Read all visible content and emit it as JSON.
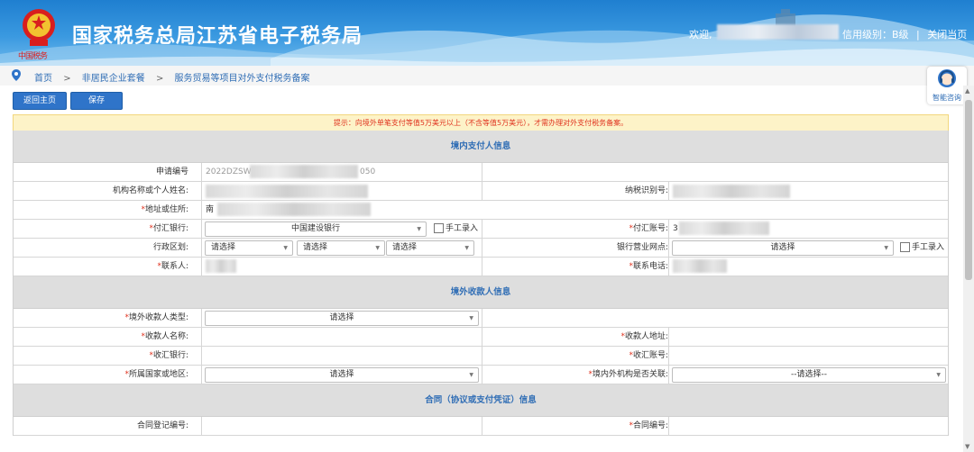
{
  "header": {
    "site_title": "国家税务总局江苏省电子税务局",
    "brand_text": "中国税务",
    "welcome": "欢迎,",
    "credit_level": "信用级别：B级",
    "separator": "|",
    "close_page": "关闭当页"
  },
  "breadcrumb": {
    "items": [
      "首页",
      "非居民企业套餐",
      "服务贸易等项目对外支付税务备案"
    ],
    "arrow": ">"
  },
  "consult": {
    "label": "智能咨询"
  },
  "toolbar": {
    "home": "返回主页",
    "save": "保存"
  },
  "notice": "提示：向境外单笔支付等值5万美元以上（不含等值5万美元），才需办理对外支付税务备案。",
  "sections": {
    "domestic": "境内支付人信息",
    "overseas": "境外收款人信息",
    "contract": "合同（协议或支付凭证）信息"
  },
  "domestic": {
    "app_no_label": "申请编号",
    "app_no_prefix": "2022DZSW",
    "app_no_suffix": "050",
    "org_name_label": "机构名称或个人姓名:",
    "tax_id_label": "纳税识别号:",
    "address_label": "地址或住所:",
    "address_prefix": "南",
    "bank_label": "付汇银行:",
    "bank_value": "中国建设银行",
    "manual_entry": "手工录入",
    "account_label": "付汇账号:",
    "account_prefix": "3",
    "region_label": "行政区划:",
    "region_selects": [
      "请选择",
      "请选择",
      "请选择"
    ],
    "branch_label": "银行营业网点:",
    "branch_value": "请选择",
    "contact_label": "联系人:",
    "phone_label": "联系电话:"
  },
  "overseas": {
    "payee_type_label": "境外收款人类型:",
    "payee_type_value": "请选择",
    "payee_name_label": "收款人名称:",
    "payee_address_label": "收款人地址:",
    "bank_label": "收汇银行:",
    "account_label": "收汇账号:",
    "country_label": "所属国家或地区:",
    "country_value": "请选择",
    "related_label": "境内外机构是否关联:",
    "related_value": "--请选择--"
  },
  "contract": {
    "reg_no_label": "合同登记编号:",
    "contract_no_label": "合同编号:"
  },
  "colors": {
    "header_blue": "#2f86d6",
    "link_blue": "#2f6db5",
    "required_red": "#e0321e",
    "notice_bg": "#fdf3c8"
  }
}
